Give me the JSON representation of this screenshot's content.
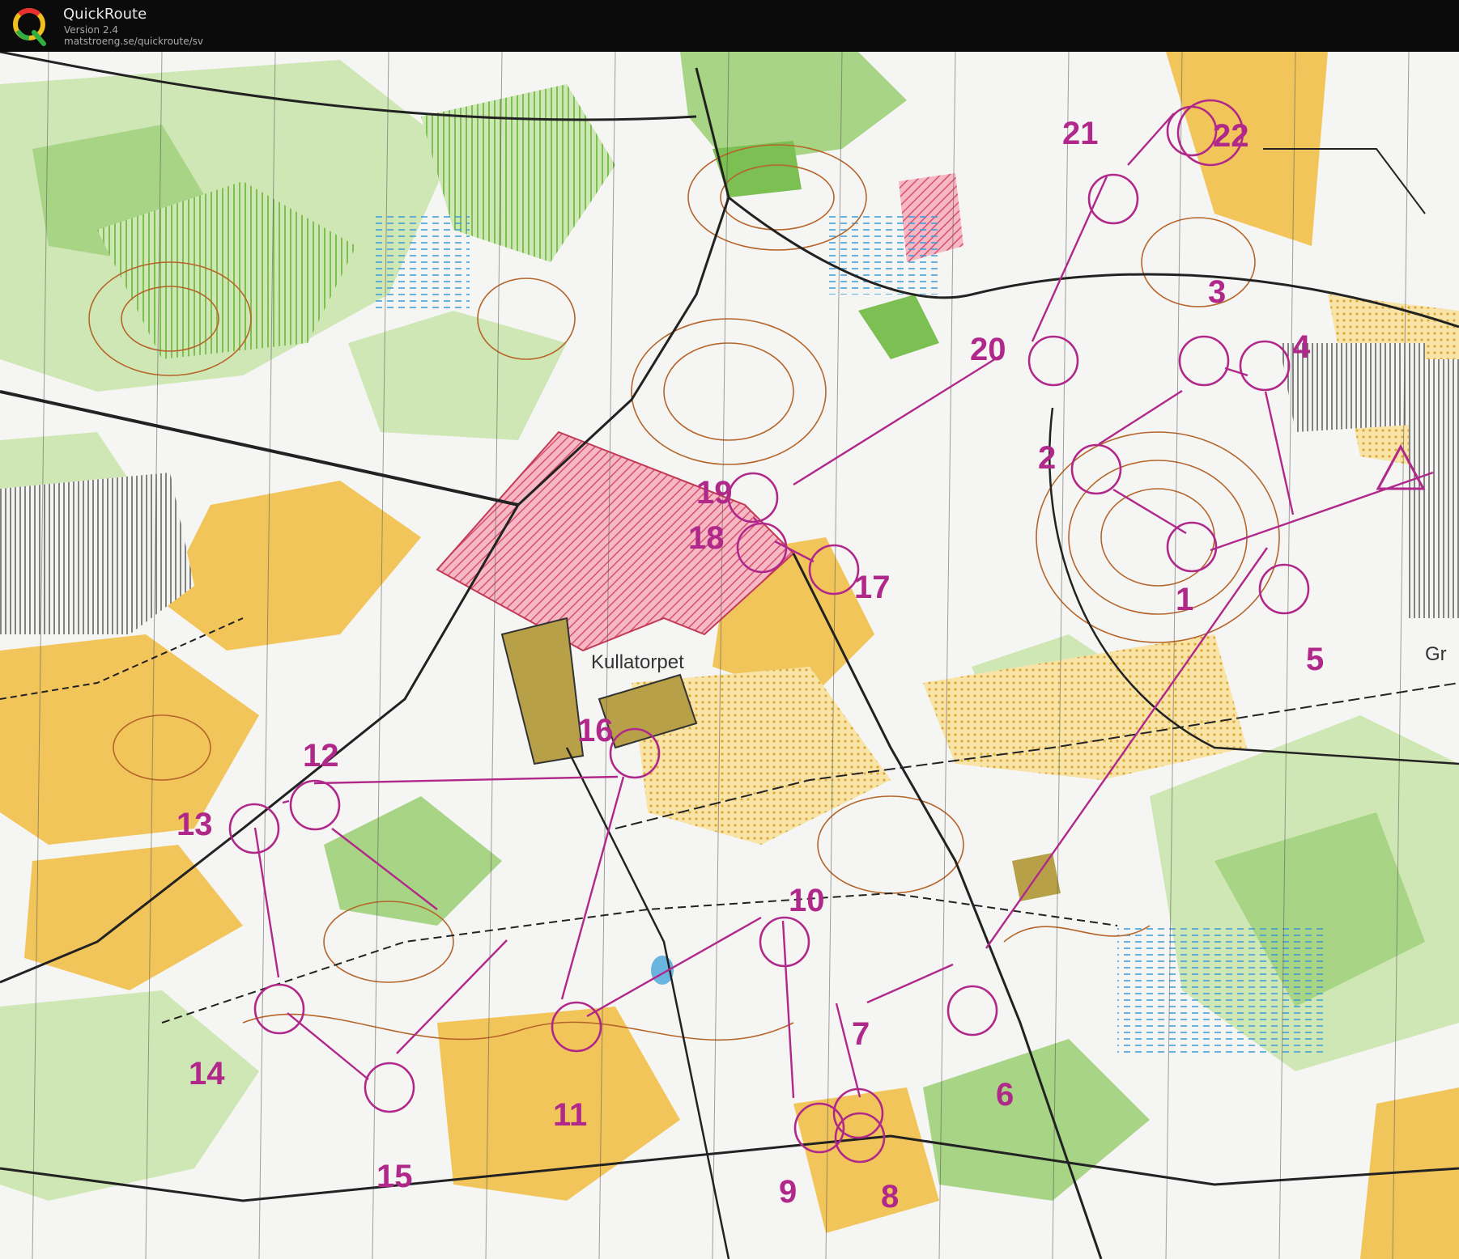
{
  "app": {
    "name": "QuickRoute",
    "version": "Version 2.4",
    "url": "matstroeng.se/quickroute/sv"
  },
  "map": {
    "place_names": [
      "Kullatorpet",
      "Gr"
    ],
    "controls": [
      {
        "label": "1"
      },
      {
        "label": "2"
      },
      {
        "label": "3"
      },
      {
        "label": "4"
      },
      {
        "label": "5"
      },
      {
        "label": "6"
      },
      {
        "label": "7"
      },
      {
        "label": "8"
      },
      {
        "label": "9"
      },
      {
        "label": "10"
      },
      {
        "label": "11"
      },
      {
        "label": "12"
      },
      {
        "label": "13"
      },
      {
        "label": "14"
      },
      {
        "label": "15"
      },
      {
        "label": "16"
      },
      {
        "label": "17"
      },
      {
        "label": "18"
      },
      {
        "label": "19"
      },
      {
        "label": "20"
      },
      {
        "label": "21"
      },
      {
        "label": "22"
      }
    ]
  },
  "colors": {
    "course": "#b0288a",
    "forest_light": "#cfe7b4",
    "forest_dark": "#7cbf52",
    "open_land": "#f2c55a",
    "contour": "#b5652a",
    "settlement": "#e8748a"
  }
}
